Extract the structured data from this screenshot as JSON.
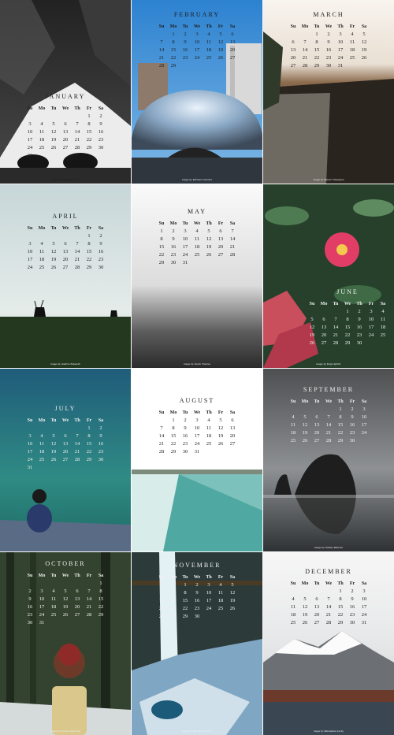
{
  "weekday_labels": [
    "Su",
    "Mo",
    "Tu",
    "We",
    "Th",
    "Fr",
    "Sa"
  ],
  "months": [
    {
      "name": "JANUARY",
      "credit": "image by Beth Barnesille",
      "weeks": [
        [
          "",
          "",
          "",
          "",
          "",
          "1",
          "2"
        ],
        [
          "3",
          "4",
          "5",
          "6",
          "7",
          "8",
          "9"
        ],
        [
          "10",
          "11",
          "12",
          "13",
          "14",
          "15",
          "16"
        ],
        [
          "17",
          "18",
          "19",
          "20",
          "21",
          "22",
          "23"
        ],
        [
          "24",
          "25",
          "26",
          "27",
          "28",
          "29",
          "30"
        ],
        [
          "31",
          "",
          "",
          "",
          "",
          "",
          ""
        ]
      ]
    },
    {
      "name": "FEBRUARY",
      "credit": "image by Michael Chinnici",
      "weeks": [
        [
          "",
          "1",
          "2",
          "3",
          "4",
          "5",
          "6"
        ],
        [
          "7",
          "8",
          "9",
          "10",
          "11",
          "12",
          "13"
        ],
        [
          "14",
          "15",
          "16",
          "17",
          "18",
          "19",
          "20"
        ],
        [
          "21",
          "22",
          "23",
          "24",
          "25",
          "26",
          "27"
        ],
        [
          "28",
          "29",
          "",
          "",
          "",
          "",
          ""
        ]
      ]
    },
    {
      "name": "MARCH",
      "credit": "image by Hunter Thompson",
      "weeks": [
        [
          "",
          "",
          "1",
          "2",
          "3",
          "4",
          "5"
        ],
        [
          "6",
          "7",
          "8",
          "9",
          "10",
          "11",
          "12"
        ],
        [
          "13",
          "14",
          "15",
          "16",
          "17",
          "18",
          "19"
        ],
        [
          "20",
          "21",
          "22",
          "23",
          "24",
          "25",
          "26"
        ],
        [
          "27",
          "28",
          "29",
          "30",
          "31",
          "",
          ""
        ]
      ]
    },
    {
      "name": "APRIL",
      "credit": "image by Andrew Edwards",
      "weeks": [
        [
          "",
          "",
          "",
          "",
          "",
          "1",
          "2"
        ],
        [
          "3",
          "4",
          "5",
          "6",
          "7",
          "8",
          "9"
        ],
        [
          "10",
          "11",
          "12",
          "13",
          "14",
          "15",
          "16"
        ],
        [
          "17",
          "18",
          "19",
          "20",
          "21",
          "22",
          "23"
        ],
        [
          "24",
          "25",
          "26",
          "27",
          "28",
          "29",
          "30"
        ]
      ]
    },
    {
      "name": "MAY",
      "credit": "image by Sarah Thomas",
      "weeks": [
        [
          "1",
          "2",
          "3",
          "4",
          "5",
          "6",
          "7"
        ],
        [
          "8",
          "9",
          "10",
          "11",
          "12",
          "13",
          "14"
        ],
        [
          "15",
          "16",
          "17",
          "18",
          "19",
          "20",
          "21"
        ],
        [
          "22",
          "23",
          "24",
          "25",
          "26",
          "27",
          "28"
        ],
        [
          "29",
          "30",
          "31",
          "",
          "",
          "",
          ""
        ]
      ]
    },
    {
      "name": "JUNE",
      "credit": "image by Katja Spitter",
      "weeks": [
        [
          "",
          "",
          "",
          "1",
          "2",
          "3",
          "4"
        ],
        [
          "5",
          "6",
          "7",
          "8",
          "9",
          "10",
          "11"
        ],
        [
          "12",
          "13",
          "14",
          "15",
          "16",
          "17",
          "18"
        ],
        [
          "19",
          "20",
          "21",
          "22",
          "23",
          "24",
          "25"
        ],
        [
          "26",
          "27",
          "28",
          "29",
          "30",
          "",
          ""
        ]
      ]
    },
    {
      "name": "JULY",
      "credit": "",
      "weeks": [
        [
          "",
          "",
          "",
          "",
          "",
          "1",
          "2"
        ],
        [
          "3",
          "4",
          "5",
          "6",
          "7",
          "8",
          "9"
        ],
        [
          "10",
          "11",
          "12",
          "13",
          "14",
          "15",
          "16"
        ],
        [
          "17",
          "18",
          "19",
          "20",
          "21",
          "22",
          "23"
        ],
        [
          "24",
          "25",
          "26",
          "27",
          "28",
          "29",
          "30"
        ],
        [
          "31",
          "",
          "",
          "",
          "",
          "",
          ""
        ]
      ]
    },
    {
      "name": "AUGUST",
      "credit": "",
      "weeks": [
        [
          "",
          "1",
          "2",
          "3",
          "4",
          "5",
          "6"
        ],
        [
          "7",
          "8",
          "9",
          "10",
          "11",
          "12",
          "13"
        ],
        [
          "14",
          "15",
          "16",
          "17",
          "18",
          "19",
          "20"
        ],
        [
          "21",
          "22",
          "23",
          "24",
          "25",
          "26",
          "27"
        ],
        [
          "28",
          "29",
          "30",
          "31",
          "",
          "",
          ""
        ]
      ]
    },
    {
      "name": "SEPTEMBER",
      "credit": "image by Nathan Ritschel",
      "weeks": [
        [
          "",
          "",
          "",
          "",
          "1",
          "2",
          "3"
        ],
        [
          "4",
          "5",
          "6",
          "7",
          "8",
          "9",
          "10"
        ],
        [
          "11",
          "12",
          "13",
          "14",
          "15",
          "16",
          "17"
        ],
        [
          "18",
          "19",
          "20",
          "21",
          "22",
          "23",
          "24"
        ],
        [
          "25",
          "26",
          "27",
          "28",
          "29",
          "30",
          ""
        ]
      ]
    },
    {
      "name": "OCTOBER",
      "credit": "image by Nathan Anderson",
      "weeks": [
        [
          "",
          "",
          "",
          "",
          "",
          "",
          "1"
        ],
        [
          "2",
          "3",
          "4",
          "5",
          "6",
          "7",
          "8"
        ],
        [
          "9",
          "10",
          "11",
          "12",
          "13",
          "14",
          "15"
        ],
        [
          "16",
          "17",
          "18",
          "19",
          "20",
          "21",
          "22"
        ],
        [
          "23",
          "24",
          "25",
          "26",
          "27",
          "28",
          "29"
        ],
        [
          "30",
          "31",
          "",
          "",
          "",
          "",
          ""
        ]
      ]
    },
    {
      "name": "NOVEMBER",
      "credit": "image by Michael Chinnici",
      "weeks": [
        [
          "",
          "",
          "1",
          "2",
          "3",
          "4",
          "5"
        ],
        [
          "6",
          "7",
          "8",
          "9",
          "10",
          "11",
          "12"
        ],
        [
          "13",
          "14",
          "15",
          "16",
          "17",
          "18",
          "19"
        ],
        [
          "20",
          "21",
          "22",
          "23",
          "24",
          "25",
          "26"
        ],
        [
          "27",
          "28",
          "29",
          "30",
          "",
          "",
          ""
        ]
      ]
    },
    {
      "name": "DECEMBER",
      "credit": "image by Manhattan Lucky",
      "weeks": [
        [
          "",
          "",
          "",
          "",
          "1",
          "2",
          "3"
        ],
        [
          "4",
          "5",
          "6",
          "7",
          "8",
          "9",
          "10"
        ],
        [
          "11",
          "12",
          "13",
          "14",
          "15",
          "16",
          "17"
        ],
        [
          "18",
          "19",
          "20",
          "21",
          "22",
          "23",
          "24"
        ],
        [
          "25",
          "26",
          "27",
          "28",
          "29",
          "30",
          "31"
        ]
      ]
    }
  ]
}
